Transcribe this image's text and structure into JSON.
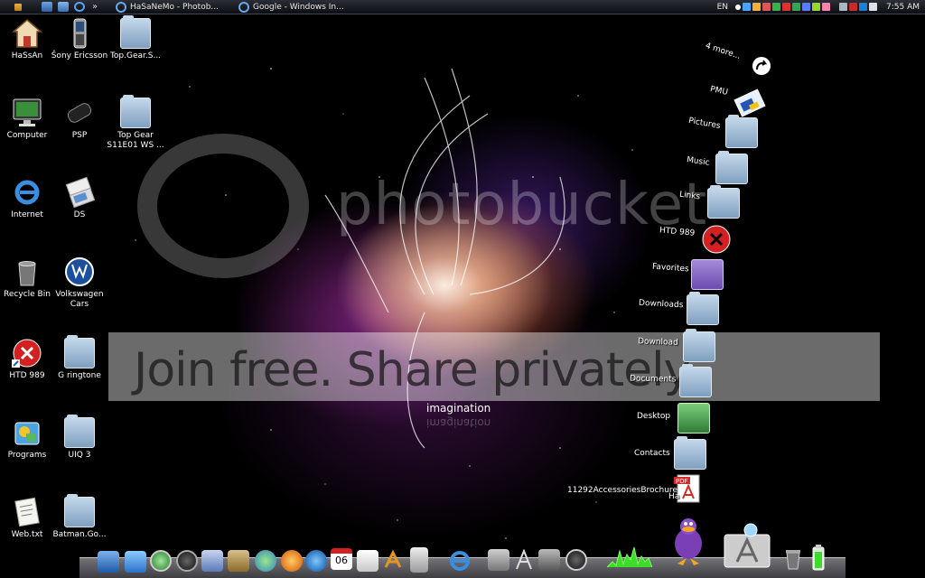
{
  "taskbar": {
    "overflow_label": "»",
    "tasks": [
      {
        "label": "HaSaNeMo - Photob..."
      },
      {
        "label": "Google - Windows In..."
      }
    ],
    "tray": {
      "language": "EN",
      "clock": "7:55 AM"
    }
  },
  "desktop": {
    "icons": [
      {
        "label": "HaSsAn"
      },
      {
        "label": "Sony Ericsson"
      },
      {
        "label": "Top.Gear.S..."
      },
      {
        "label": "Computer"
      },
      {
        "label": "PSP"
      },
      {
        "label": "Top Gear S11E01 WS ..."
      },
      {
        "label": "Internet"
      },
      {
        "label": "DS"
      },
      {
        "label": "Recycle Bin"
      },
      {
        "label": "Volkswagen Cars"
      },
      {
        "label": "HTD 989"
      },
      {
        "label": "G ringtone"
      },
      {
        "label": "Programs"
      },
      {
        "label": "UIQ 3"
      },
      {
        "label": "Web.txt"
      },
      {
        "label": "Batman.Go..."
      }
    ]
  },
  "wallpaper": {
    "caption": "imagination"
  },
  "watermark": {
    "brand": "photobucket",
    "slogan": "Join free. Share privately."
  },
  "stack": {
    "more_label": "4 more...",
    "items": [
      {
        "label": "PMU"
      },
      {
        "label": "Pictures"
      },
      {
        "label": "Music"
      },
      {
        "label": "Links"
      },
      {
        "label": "HTD 989"
      },
      {
        "label": "Favorites"
      },
      {
        "label": "Downloads"
      },
      {
        "label": "Download"
      },
      {
        "label": "Documents"
      },
      {
        "label": "Desktop"
      },
      {
        "label": "Contacts"
      },
      {
        "label": "11292AccessoriesBrochure"
      }
    ],
    "partial_label": "Ha"
  },
  "dock": {
    "calendar_day": "06"
  },
  "colors": {
    "accent_folder": "#9fbcd9",
    "error_red": "#d32020",
    "meter_green": "#3ddc2a"
  }
}
